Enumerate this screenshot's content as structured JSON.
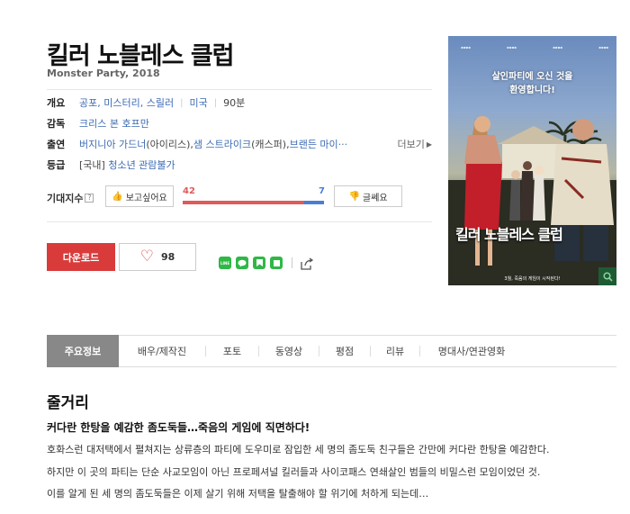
{
  "movie": {
    "title": "킬러 노블레스 클럽",
    "subtitle": "Monster Party, 2018"
  },
  "info": {
    "overview_label": "개요",
    "genres": "공포, 미스터리, 스릴러",
    "country": "미국",
    "runtime": "90분",
    "director_label": "감독",
    "director": "크리스 본 호프만",
    "cast_label": "출연",
    "cast": "버지니아 가드너",
    "cast_role": "(아이리스), ",
    "cast2": "샘 스트라이크",
    "cast2_role": "(캐스퍼), ",
    "cast3": "브랜든 마이···",
    "more": "더보기",
    "rating_label": "등급",
    "rating_region": "[국내]",
    "rating": "청소년 관람불가"
  },
  "expectation": {
    "label": "기대지수",
    "help": "?",
    "want_label": "보고싶어요",
    "want_count": 42,
    "meh_label": "글쎄요",
    "meh_count": 7,
    "want_color": "#e05a5a",
    "meh_color": "#4a7ed4"
  },
  "actions": {
    "download_label": "다운로드",
    "like_count": "98"
  },
  "share": {
    "icons": [
      "line-icon",
      "kakaotalk-icon",
      "band-icon",
      "kakaostory-icon"
    ],
    "line_text": "LINE"
  },
  "poster": {
    "tagline_1": "살인파티에 오신 것을",
    "tagline_2": "환영합니다!",
    "title": "킬러 노블레스 클럽",
    "release": "3월, 죽음의 게임이 시작된다!"
  },
  "tabs": [
    "주요정보",
    "배우/제작진",
    "포토",
    "동영상",
    "평점",
    "리뷰",
    "명대사/연관영화"
  ],
  "plot": {
    "title": "줄거리",
    "headline": "커다란 한탕을 예감한 좀도둑들…죽음의 게임에 직면하다!",
    "line1": "호화스런 대저택에서 펼쳐지는 상류층의 파티에 도우미로 잠입한 세 명의 좀도둑 친구들은 간만에 커다란 한탕을 예감한다.",
    "line2": "하지만 이 곳의 파티는 단순 사교모임이 아닌 프로페셔널 킬러들과 사이코패스 연쇄살인 범들의 비밀스런 모임이었던 것.",
    "line3": " 이를 알게 된 세 명의 좀도둑들은 이제 살기 위해 저택을 탈출해야 할 위기에 처하게 되는데…"
  }
}
